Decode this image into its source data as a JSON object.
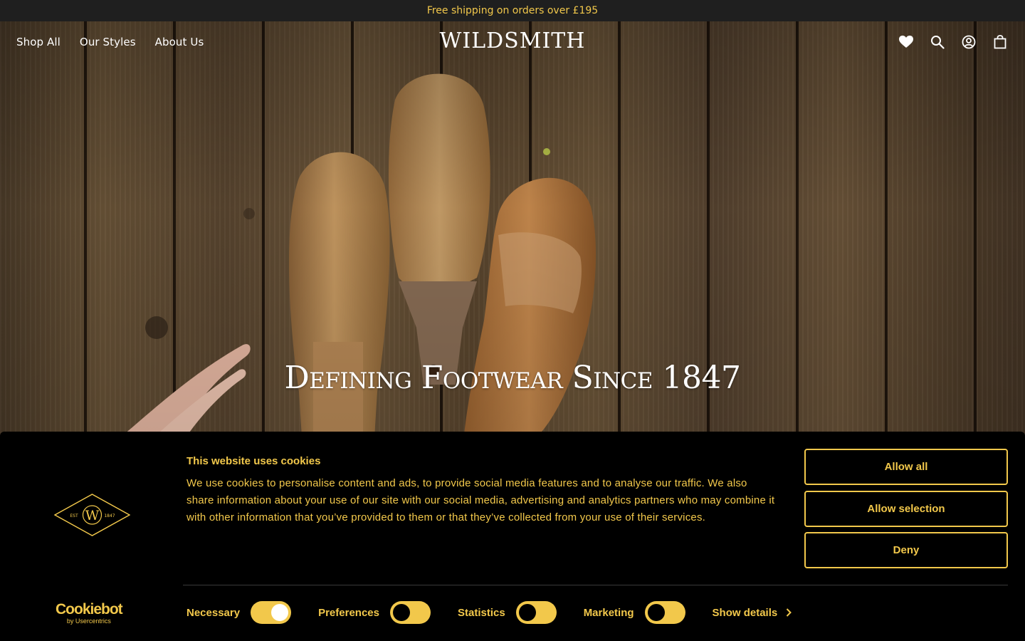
{
  "announcement": {
    "text": "Free shipping on orders over £195"
  },
  "header": {
    "nav": [
      {
        "label": "Shop All"
      },
      {
        "label": "Our Styles"
      },
      {
        "label": "About Us"
      }
    ],
    "logo_text": "WILDSMITH",
    "icons": [
      "heart-icon",
      "search-icon",
      "account-icon",
      "bag-icon"
    ]
  },
  "hero": {
    "title": "Defining Footwear Since 1847"
  },
  "cookie_banner": {
    "heading": "This website uses cookies",
    "body": "We use cookies to personalise content and ads, to provide social media features and to analyse our traffic. We also share information about your use of our site with our social media, advertising and analytics partners who may combine it with other information that you’ve provided to them or that they’ve collected from your use of their services.",
    "buttons": {
      "allow_all": "Allow all",
      "allow_selection": "Allow selection",
      "deny": "Deny"
    },
    "consents": [
      {
        "label": "Necessary",
        "enabled": true
      },
      {
        "label": "Preferences",
        "enabled": false
      },
      {
        "label": "Statistics",
        "enabled": false
      },
      {
        "label": "Marketing",
        "enabled": false
      }
    ],
    "show_details": "Show details",
    "brand_emblem": {
      "est": "EST",
      "year": "1847",
      "monogram": "W"
    },
    "provider": {
      "name": "Cookiebot",
      "sub": "by Usercentrics"
    }
  },
  "colors": {
    "accent": "#f2c84b",
    "banner_bg": "#000000",
    "announce_bg": "#1f1f1f"
  }
}
